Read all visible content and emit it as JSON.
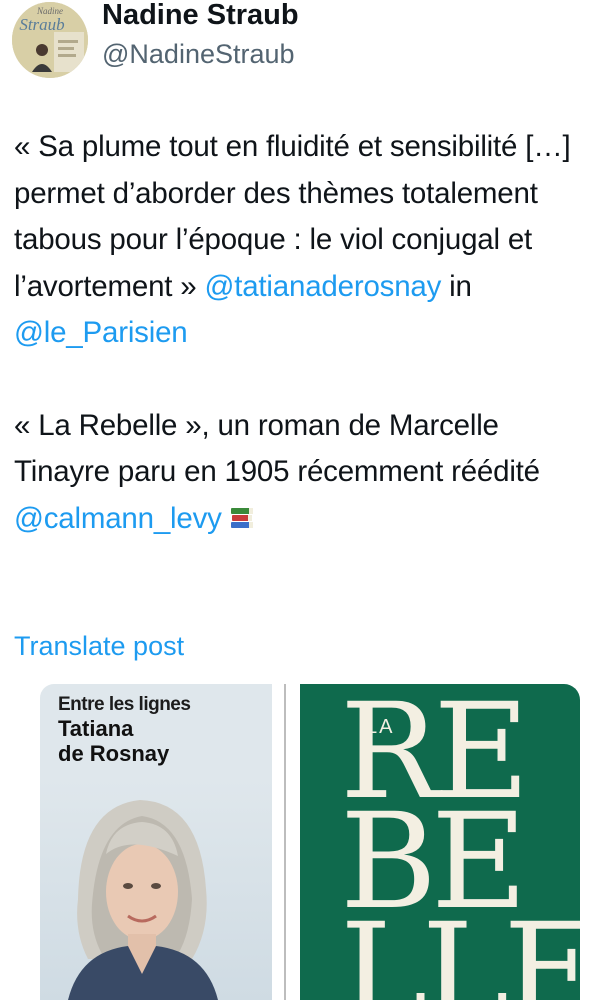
{
  "author": {
    "name": "Nadine Straub",
    "handle": "@NadineStraub",
    "avatar_lines": [
      "Nadine",
      "Straub"
    ]
  },
  "tweet": {
    "p1_a": "« Sa plume tout en fluidité et sensibilité […] permet d’aborder des thèmes totalement tabous pour l’époque : le viol conjugal et l’avortement » ",
    "p1_mention1": "@tatianaderosnay",
    "p1_in": " in ",
    "p1_mention2": "@le_Parisien",
    "p2_a": "« La Rebelle », un roman de Marcelle Tinayre paru en 1905 récemment réédité ",
    "p2_mention": "@calmann_levy",
    "emoji_icon": "books-emoji"
  },
  "translate_label": "Translate post",
  "media": {
    "left_panel": {
      "kicker": "Entre les lignes",
      "author_line1": "Tatiana",
      "author_line2": "de Rosnay",
      "bg_color": "#dfe7ec"
    },
    "right_panel": {
      "article": "LA",
      "line1": "RE",
      "line2": "BE",
      "line3": "LLE",
      "bg_color": "#0f6a4d",
      "text_color": "#f3efe2"
    }
  },
  "colors": {
    "link": "#1d9bf0",
    "text": "#0f1419",
    "secondary": "#536471"
  }
}
